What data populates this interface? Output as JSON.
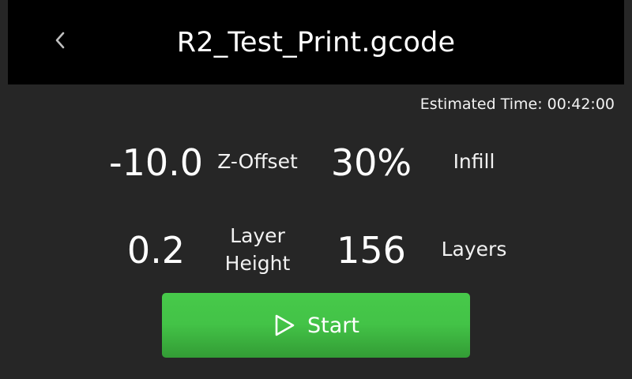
{
  "header": {
    "title": "R2_Test_Print.gcode",
    "back_icon": "chevron-left-icon"
  },
  "estimated_time": "Estimated Time: 00:42:00",
  "stats": {
    "z_offset": {
      "value": "-10.0",
      "label": "Z-Offset"
    },
    "infill": {
      "value": "30%",
      "label": "Infill"
    },
    "layer_height": {
      "value": "0.2",
      "label": "Layer\nHeight"
    },
    "layers": {
      "value": "156",
      "label": "Layers"
    }
  },
  "start_button": {
    "label": "Start",
    "icon": "play-icon"
  },
  "colors": {
    "background": "#262626",
    "header": "#000000",
    "button_green": "#43c347"
  }
}
